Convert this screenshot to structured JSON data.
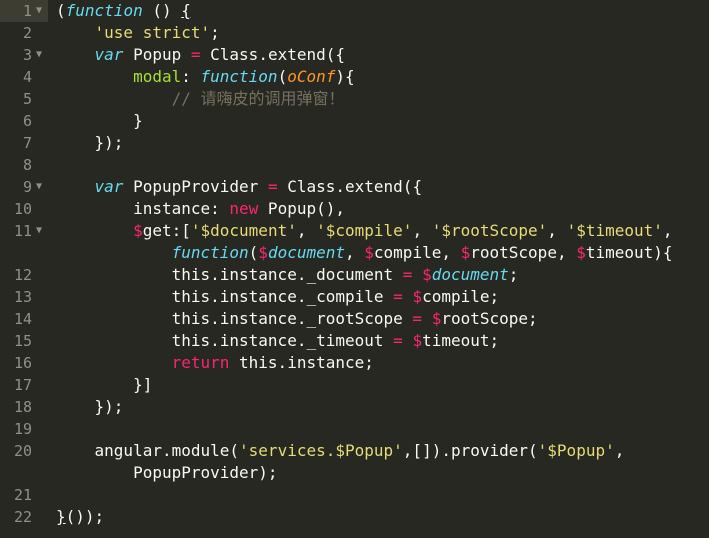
{
  "editor": {
    "theme_colors": {
      "background": "#272822",
      "plain": "#f8f8f2",
      "keyword": "#66d9ef",
      "string": "#e6db74",
      "operator": "#f92672",
      "property": "#a6e22e",
      "parameter": "#fd971f",
      "comment": "#75715e",
      "gutter": "#90908a"
    },
    "current_line": 1,
    "lines": [
      {
        "n": "1",
        "fold": true,
        "indent": 0,
        "tokens": [
          [
            "p",
            "("
          ],
          [
            "k",
            "function"
          ],
          [
            "p",
            " () "
          ],
          [
            "u",
            "{"
          ]
        ]
      },
      {
        "n": "2",
        "indent": 4,
        "tokens": [
          [
            "s",
            "'use strict'"
          ],
          [
            "p",
            ";"
          ]
        ]
      },
      {
        "n": "3",
        "fold": true,
        "indent": 4,
        "tokens": [
          [
            "k",
            "var"
          ],
          [
            "p",
            " Popup "
          ],
          [
            "o",
            "="
          ],
          [
            "p",
            " Class.extend({"
          ]
        ]
      },
      {
        "n": "4",
        "indent": 8,
        "tokens": [
          [
            "g",
            "modal"
          ],
          [
            "p",
            ": "
          ],
          [
            "k",
            "function"
          ],
          [
            "p",
            "("
          ],
          [
            "a",
            "oConf"
          ],
          [
            "p",
            "){"
          ]
        ]
      },
      {
        "n": "5",
        "indent": 12,
        "tokens": [
          [
            "c",
            "// 请嗨皮的调用弹窗！"
          ]
        ]
      },
      {
        "n": "6",
        "indent": 8,
        "tokens": [
          [
            "p",
            "}"
          ]
        ]
      },
      {
        "n": "7",
        "indent": 4,
        "tokens": [
          [
            "p",
            "});"
          ]
        ]
      },
      {
        "n": "8",
        "indent": 0,
        "tokens": []
      },
      {
        "n": "9",
        "fold": true,
        "indent": 4,
        "tokens": [
          [
            "k",
            "var"
          ],
          [
            "p",
            " PopupProvider "
          ],
          [
            "o",
            "="
          ],
          [
            "p",
            " Class.extend({"
          ]
        ]
      },
      {
        "n": "10",
        "indent": 8,
        "tokens": [
          [
            "p",
            "instance: "
          ],
          [
            "o",
            "new"
          ],
          [
            "p",
            " Popup(),"
          ]
        ]
      },
      {
        "n": "11",
        "fold": true,
        "indent": 8,
        "tokens": [
          [
            "d",
            "$"
          ],
          [
            "p",
            "get:["
          ],
          [
            "s",
            "'$document'"
          ],
          [
            "p",
            ", "
          ],
          [
            "s",
            "'$compile'"
          ],
          [
            "p",
            ", "
          ],
          [
            "s",
            "'$rootScope'"
          ],
          [
            "p",
            ", "
          ],
          [
            "s",
            "'$timeout'"
          ],
          [
            "p",
            ","
          ]
        ]
      },
      {
        "n": "",
        "indent": 12,
        "tokens": [
          [
            "k",
            "function"
          ],
          [
            "p",
            "("
          ],
          [
            "d",
            "$"
          ],
          [
            "k",
            "document"
          ],
          [
            "p",
            ", "
          ],
          [
            "d",
            "$"
          ],
          [
            "p",
            "compile, "
          ],
          [
            "d",
            "$"
          ],
          [
            "p",
            "rootScope, "
          ],
          [
            "d",
            "$"
          ],
          [
            "p",
            "timeout){"
          ]
        ]
      },
      {
        "n": "12",
        "indent": 12,
        "tokens": [
          [
            "p",
            "this.instance._document "
          ],
          [
            "o",
            "="
          ],
          [
            "p",
            " "
          ],
          [
            "d",
            "$"
          ],
          [
            "k",
            "document"
          ],
          [
            "p",
            ";"
          ]
        ]
      },
      {
        "n": "13",
        "indent": 12,
        "tokens": [
          [
            "p",
            "this.instance._compile "
          ],
          [
            "o",
            "="
          ],
          [
            "p",
            " "
          ],
          [
            "d",
            "$"
          ],
          [
            "p",
            "compile;"
          ]
        ]
      },
      {
        "n": "14",
        "indent": 12,
        "tokens": [
          [
            "p",
            "this.instance._rootScope "
          ],
          [
            "o",
            "="
          ],
          [
            "p",
            " "
          ],
          [
            "d",
            "$"
          ],
          [
            "p",
            "rootScope;"
          ]
        ]
      },
      {
        "n": "15",
        "indent": 12,
        "tokens": [
          [
            "p",
            "this.instance._timeout "
          ],
          [
            "o",
            "="
          ],
          [
            "p",
            " "
          ],
          [
            "d",
            "$"
          ],
          [
            "p",
            "timeout;"
          ]
        ]
      },
      {
        "n": "16",
        "indent": 12,
        "tokens": [
          [
            "o",
            "return"
          ],
          [
            "p",
            " this.instance;"
          ]
        ]
      },
      {
        "n": "17",
        "indent": 8,
        "tokens": [
          [
            "p",
            "}]"
          ]
        ]
      },
      {
        "n": "18",
        "indent": 4,
        "tokens": [
          [
            "p",
            "});"
          ]
        ]
      },
      {
        "n": "19",
        "indent": 0,
        "tokens": []
      },
      {
        "n": "20",
        "indent": 4,
        "tokens": [
          [
            "p",
            "angular.module("
          ],
          [
            "s",
            "'services.$Popup'"
          ],
          [
            "p",
            ",[]).provider("
          ],
          [
            "s",
            "'$Popup'"
          ],
          [
            "p",
            ","
          ]
        ]
      },
      {
        "n": "",
        "indent": 8,
        "tokens": [
          [
            "p",
            "PopupProvider);"
          ]
        ]
      },
      {
        "n": "21",
        "indent": 0,
        "tokens": []
      },
      {
        "n": "22",
        "indent": 0,
        "tokens": [
          [
            "u",
            "}"
          ],
          [
            "p",
            "());"
          ]
        ]
      }
    ]
  }
}
